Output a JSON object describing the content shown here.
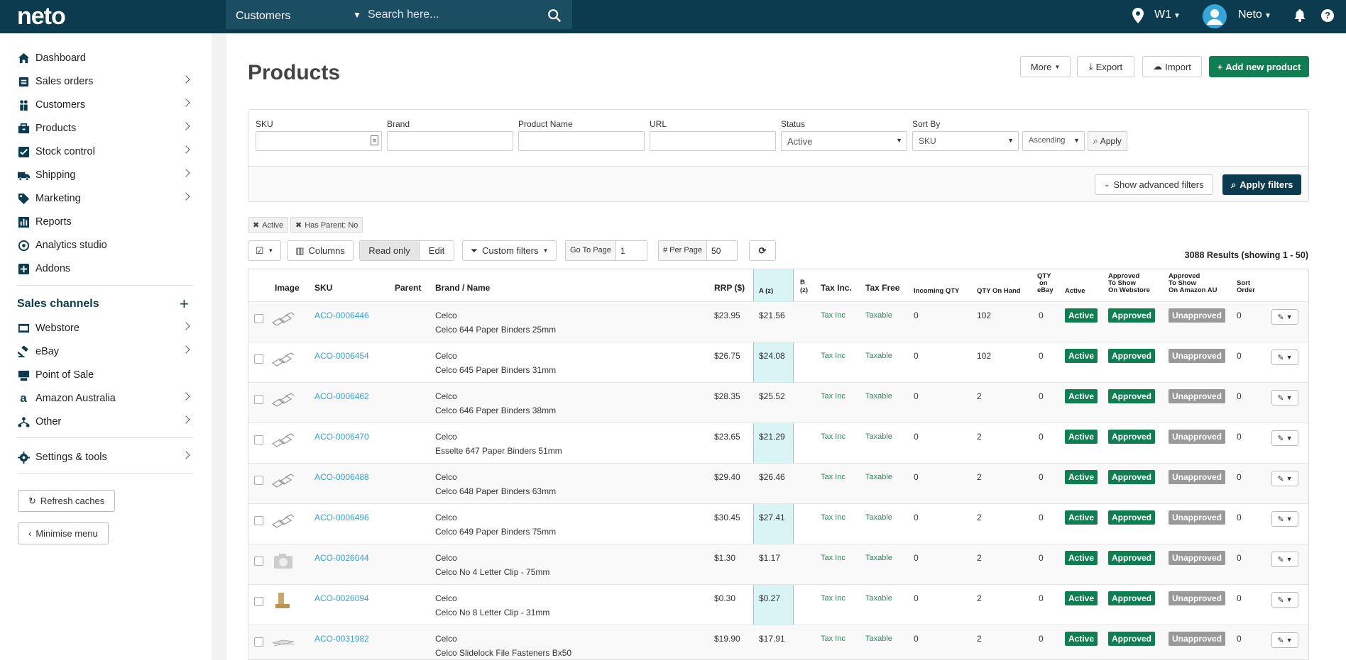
{
  "topbar": {
    "logo": "neto",
    "search_scope": "Customers",
    "search_placeholder": "Search here...",
    "location": "W1",
    "user": "Neto",
    "help": "?"
  },
  "sidebar": {
    "items": [
      {
        "label": "Dashboard",
        "icon": "home-icon"
      },
      {
        "label": "Sales orders",
        "icon": "cart-icon"
      },
      {
        "label": "Customers",
        "icon": "users-icon"
      },
      {
        "label": "Products",
        "icon": "box-icon"
      },
      {
        "label": "Stock control",
        "icon": "check-square-icon"
      },
      {
        "label": "Shipping",
        "icon": "truck-icon"
      },
      {
        "label": "Marketing",
        "icon": "tag-icon"
      },
      {
        "label": "Reports",
        "icon": "bar-chart-icon"
      },
      {
        "label": "Analytics studio",
        "icon": "analytics-icon"
      },
      {
        "label": "Addons",
        "icon": "plus-square-icon"
      }
    ],
    "sales_channels_title": "Sales channels",
    "channels": [
      {
        "label": "Webstore",
        "icon": "store-icon"
      },
      {
        "label": "eBay",
        "icon": "gavel-icon"
      },
      {
        "label": "Point of Sale",
        "icon": "pos-icon"
      },
      {
        "label": "Amazon Australia",
        "icon": "amazon-icon"
      },
      {
        "label": "Other",
        "icon": "sitemap-icon"
      }
    ],
    "settings": "Settings & tools",
    "refresh_caches": "Refresh caches",
    "minimise_menu": "Minimise menu"
  },
  "page": {
    "title": "Products",
    "more": "More",
    "export": "Export",
    "import": "Import",
    "add_new": "Add new product"
  },
  "filters": {
    "sku_label": "SKU",
    "brand_label": "Brand",
    "name_label": "Product Name",
    "url_label": "URL",
    "status_label": "Status",
    "status_value": "Active",
    "sortby_label": "Sort By",
    "sortby_value": "SKU",
    "order_value": "Ascending",
    "apply": "Apply",
    "show_advanced": "Show advanced filters",
    "apply_filters": "Apply filters",
    "chips": [
      "Active",
      "Has Parent: No"
    ]
  },
  "toolbar": {
    "columns": "Columns",
    "read_only": "Read only",
    "edit": "Edit",
    "custom_filters": "Custom filters",
    "go_to_page_label": "Go To Page",
    "go_to_page": "1",
    "per_page_label": "# Per Page",
    "per_page": "50",
    "results": "3088 Results (showing 1 - 50)"
  },
  "table": {
    "headers": {
      "image": "Image",
      "sku": "SKU",
      "parent": "Parent",
      "brand_name": "Brand / Name",
      "rrp": "RRP ($)",
      "a": "A (z)",
      "b1": "B",
      "b2": "(z)",
      "tax_inc": "Tax Inc.",
      "tax_free": "Tax Free",
      "incoming": "Incoming QTY",
      "on_hand": "QTY On Hand",
      "ebay1": "QTY",
      "ebay2": "on",
      "ebay3": "eBay",
      "active": "Active",
      "web1": "Approved",
      "web2": "To Show",
      "web3": "On Webstore",
      "amz1": "Approved",
      "amz2": "To Show",
      "amz3": "On Amazon AU",
      "sort1": "Sort",
      "sort2": "Order"
    },
    "rows": [
      {
        "sku": "ACO-0006446",
        "brand": "Celco",
        "name": "Celco 644 Paper Binders 25mm",
        "rrp": "$23.95",
        "a": "$21.56",
        "tax_inc": "Tax Inc",
        "tax_free": "Taxable",
        "incoming": "0",
        "on_hand": "102",
        "ebay": "0",
        "active": "Active",
        "web": "Approved",
        "amz": "Unapproved",
        "sort": "0",
        "img": "binder"
      },
      {
        "sku": "ACO-0006454",
        "brand": "Celco",
        "name": "Celco 645 Paper Binders 31mm",
        "rrp": "$26.75",
        "a": "$24.08",
        "tax_inc": "Tax Inc",
        "tax_free": "Taxable",
        "incoming": "0",
        "on_hand": "102",
        "ebay": "0",
        "active": "Active",
        "web": "Approved",
        "amz": "Unapproved",
        "sort": "0",
        "img": "binder"
      },
      {
        "sku": "ACO-0006462",
        "brand": "Celco",
        "name": "Celco 646 Paper Binders 38mm",
        "rrp": "$28.35",
        "a": "$25.52",
        "tax_inc": "Tax Inc",
        "tax_free": "Taxable",
        "incoming": "0",
        "on_hand": "2",
        "ebay": "0",
        "active": "Active",
        "web": "Approved",
        "amz": "Unapproved",
        "sort": "0",
        "img": "binder"
      },
      {
        "sku": "ACO-0006470",
        "brand": "Celco",
        "name": "Esselte 647 Paper Binders 51mm",
        "rrp": "$23.65",
        "a": "$21.29",
        "tax_inc": "Tax Inc",
        "tax_free": "Taxable",
        "incoming": "0",
        "on_hand": "2",
        "ebay": "0",
        "active": "Active",
        "web": "Approved",
        "amz": "Unapproved",
        "sort": "0",
        "img": "binder"
      },
      {
        "sku": "ACO-0006488",
        "brand": "Celco",
        "name": "Celco 648 Paper Binders 63mm",
        "rrp": "$29.40",
        "a": "$26.46",
        "tax_inc": "Tax Inc",
        "tax_free": "Taxable",
        "incoming": "0",
        "on_hand": "2",
        "ebay": "0",
        "active": "Active",
        "web": "Approved",
        "amz": "Unapproved",
        "sort": "0",
        "img": "binder"
      },
      {
        "sku": "ACO-0006496",
        "brand": "Celco",
        "name": "Celco 649 Paper Binders 75mm",
        "rrp": "$30.45",
        "a": "$27.41",
        "tax_inc": "Tax Inc",
        "tax_free": "Taxable",
        "incoming": "0",
        "on_hand": "2",
        "ebay": "0",
        "active": "Active",
        "web": "Approved",
        "amz": "Unapproved",
        "sort": "0",
        "img": "binder"
      },
      {
        "sku": "ACO-0026044",
        "brand": "Celco",
        "name": "Celco No 4 Letter Clip - 75mm",
        "rrp": "$1.30",
        "a": "$1.17",
        "tax_inc": "Tax Inc",
        "tax_free": "Taxable",
        "incoming": "0",
        "on_hand": "2",
        "ebay": "0",
        "active": "Active",
        "web": "Approved",
        "amz": "Unapproved",
        "sort": "0",
        "img": "camera"
      },
      {
        "sku": "ACO-0026094",
        "brand": "Celco",
        "name": "Celco No 8 Letter Clip - 31mm",
        "rrp": "$0.30",
        "a": "$0.27",
        "tax_inc": "Tax Inc",
        "tax_free": "Taxable",
        "incoming": "0",
        "on_hand": "2",
        "ebay": "0",
        "active": "Active",
        "web": "Approved",
        "amz": "Unapproved",
        "sort": "0",
        "img": "clip"
      },
      {
        "sku": "ACO-0031982",
        "brand": "Celco",
        "name": "Celco Slidelock File Fasteners Bx50",
        "rrp": "$19.90",
        "a": "$17.91",
        "tax_inc": "Tax Inc",
        "tax_free": "Taxable",
        "incoming": "0",
        "on_hand": "2",
        "ebay": "0",
        "active": "Active",
        "web": "Approved",
        "amz": "Unapproved",
        "sort": "0",
        "img": "fastener"
      }
    ]
  },
  "colors": {
    "topbar": "#0c3b4f",
    "accent_green": "#0f7f52",
    "link": "#3aa0d6",
    "highlight_col": "#d9f4f4"
  }
}
